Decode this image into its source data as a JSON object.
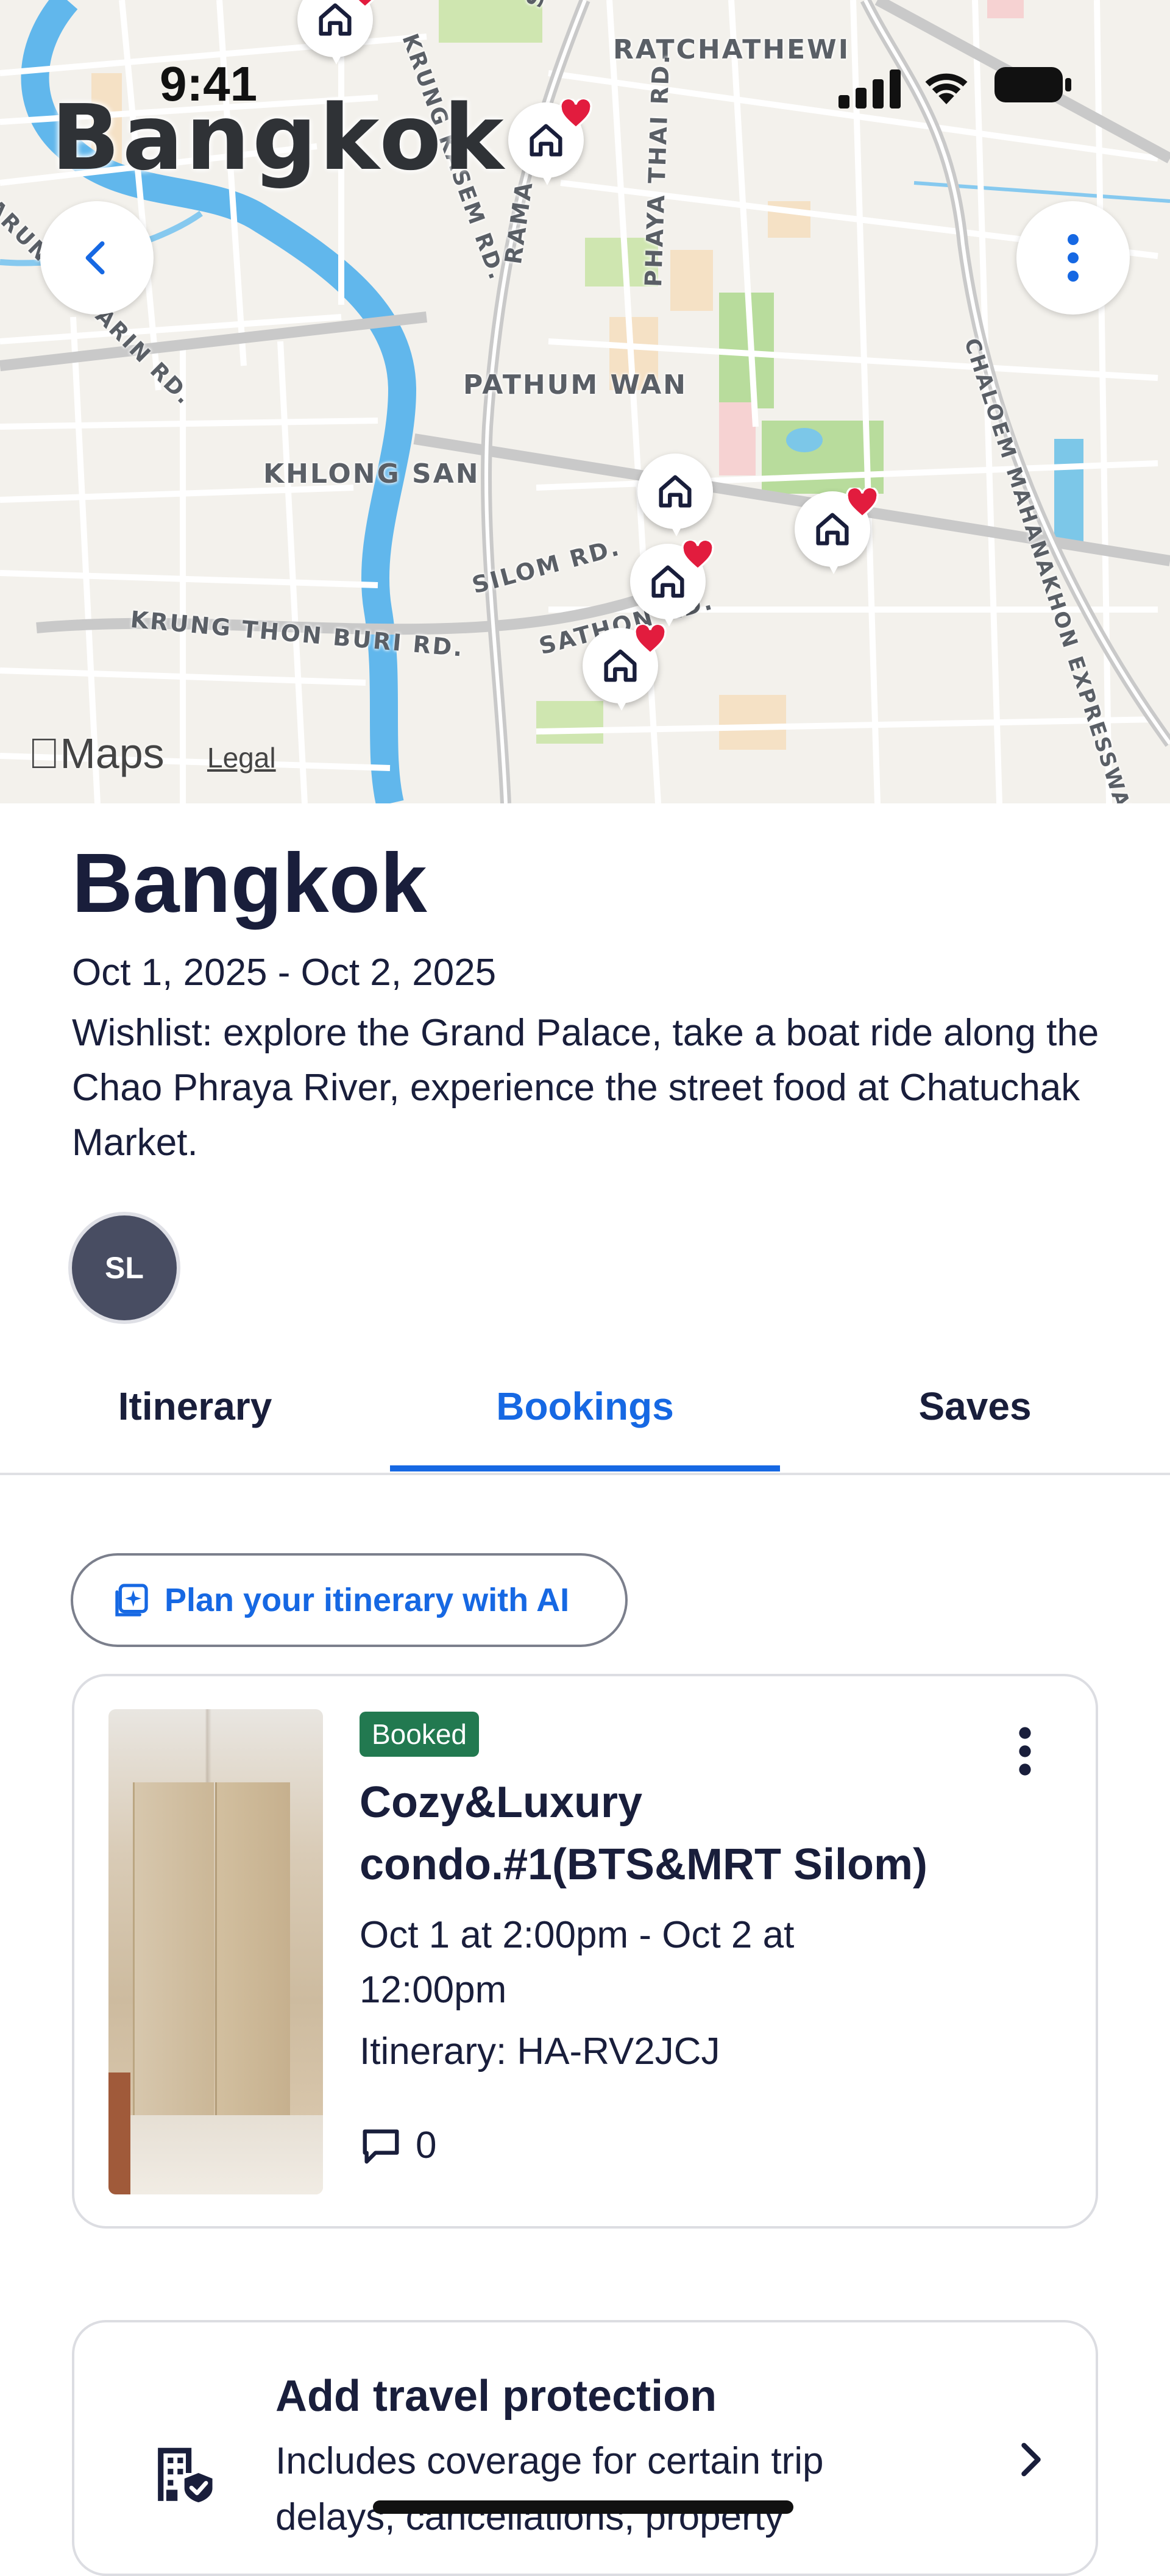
{
  "status_bar": {
    "time": "9:41"
  },
  "map": {
    "city_label": "Bangkok",
    "area_labels": [
      "RATCHATHEWI",
      "PATHUM WAN",
      "KHLONG SAN",
      "KRUNG THON BURI RD.",
      "SILOM RD.",
      "SATHON RD.",
      "PHAYA THAI RD.",
      "RAMA",
      "KRUNG KASEM RD.",
      "CHALOEM MAHANAKHON EXPRESSWAY",
      "ARUN AMMARIN RD.",
      "SAWA"
    ],
    "attribution": "Maps",
    "legal": "Legal",
    "pins": [
      {
        "name": "property-pin",
        "favorited": true
      },
      {
        "name": "property-pin",
        "favorited": true
      },
      {
        "name": "property-pin",
        "favorited": false
      },
      {
        "name": "property-pin",
        "favorited": true
      },
      {
        "name": "property-pin",
        "favorited": true
      },
      {
        "name": "property-pin",
        "favorited": true
      }
    ],
    "back_icon": "chevron-left-icon",
    "more_icon": "more-vertical-icon"
  },
  "trip": {
    "title": "Bangkok",
    "dates": "Oct 1, 2025 - Oct 2, 2025",
    "description": "Wishlist: explore the Grand Palace, take a boat ride along the Chao Phraya River, experience the street food at Chatuchak Market.",
    "avatar_initials": "SL"
  },
  "tabs": [
    {
      "label": "Itinerary",
      "active": false
    },
    {
      "label": "Bookings",
      "active": true
    },
    {
      "label": "Saves",
      "active": false
    }
  ],
  "ai_button": {
    "label": "Plan your itinerary with AI",
    "icon": "ai-sparkle-icon"
  },
  "booking": {
    "status": "Booked",
    "name": "Cozy&Luxury condo.#1(BTS&MRT Silom)",
    "dates": "Oct 1 at 2:00pm - Oct 2 at 12:00pm",
    "itinerary": "Itinerary: HA-RV2JCJ",
    "comments": "0",
    "status_color": "#227950"
  },
  "protection": {
    "title": "Add travel protection",
    "description": "Includes coverage for certain trip delays, cancellations, property"
  },
  "colors": {
    "accent": "#1668e3",
    "text": "#191e3b",
    "heart": "#e21c3e"
  }
}
